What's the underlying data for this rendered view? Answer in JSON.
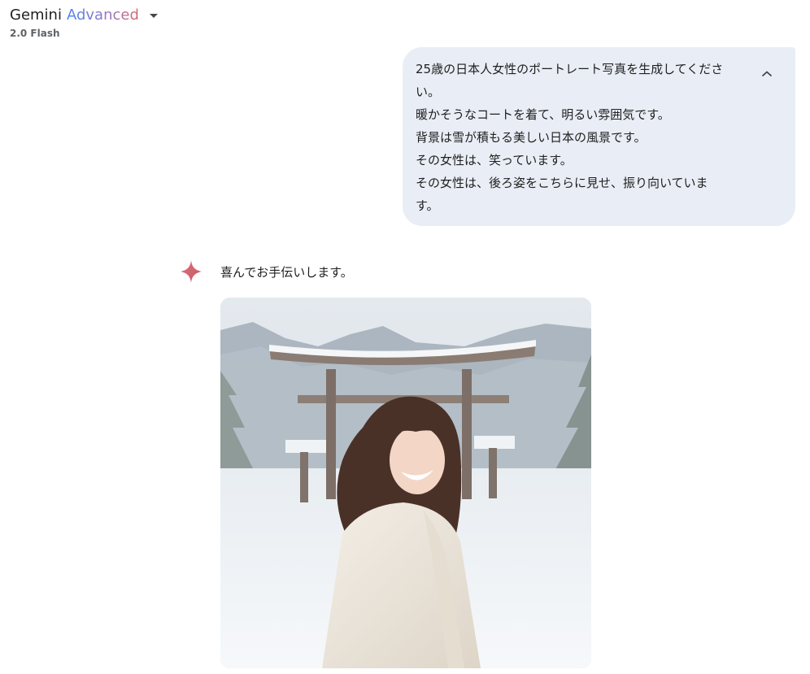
{
  "header": {
    "title_primary": "Gemini",
    "title_secondary": "Advanced",
    "model_version": "2.0 Flash",
    "dropdown_icon": "caret-down-icon"
  },
  "user_message": {
    "lines": [
      "25歳の日本人女性のポートレート写真を生成してくださ",
      "い。",
      "暖かそうなコートを着て、明るい雰囲気です。",
      "背景は雪が積もる美しい日本の風景です。",
      "その女性は、笑っています。",
      "その女性は、後ろ姿をこちらに見せ、振り向いていま",
      "す。"
    ],
    "collapse_icon": "chevron-up-icon"
  },
  "response": {
    "avatar_icon": "gemini-sparkle-icon",
    "text": "喜んでお手伝いします。",
    "image_description": "generated-portrait-image"
  },
  "colors": {
    "bubble_bg": "#e9eef6",
    "sparkle": "#d96570",
    "advanced_gradient_start": "#4f86f0",
    "advanced_gradient_end": "#d96570"
  }
}
